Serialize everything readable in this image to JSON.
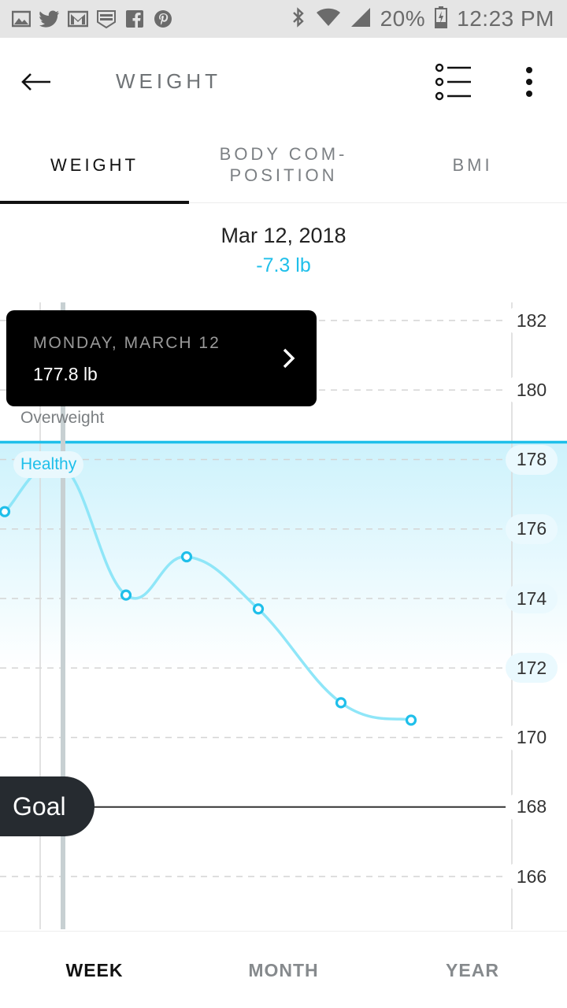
{
  "status_bar": {
    "left_icons": [
      "image-icon",
      "twitter-icon",
      "gmail-icon",
      "crossfit-games-icon",
      "facebook-icon",
      "pinterest-icon"
    ],
    "right_icons": [
      "bluetooth-icon",
      "wifi-icon",
      "cell-signal-icon",
      "battery-icon"
    ],
    "battery": "20%",
    "time": "12:23 PM"
  },
  "app_bar": {
    "title": "WEIGHT"
  },
  "tabs": [
    {
      "label": "WEIGHT",
      "active": true
    },
    {
      "label": "BODY COM-\nPOSITION",
      "active": false
    },
    {
      "label": "BMI",
      "active": false
    }
  ],
  "summary": {
    "date": "Mar 12, 2018",
    "delta": "-7.3 lb"
  },
  "tooltip": {
    "day": "MONDAY, MARCH 12",
    "value": "177.8 lb"
  },
  "zones": {
    "overweight_label": "Overweight",
    "healthy_label": "Healthy",
    "boundary": 178.5
  },
  "goal": {
    "label": "Goal",
    "value": 168
  },
  "colors": {
    "accent": "#1fbfea",
    "line": "#8fe6f8",
    "healthy_fill": "#cdf2fc",
    "tooltip_bg": "#000000",
    "goal_pill": "#262b30"
  },
  "chart_data": {
    "type": "line",
    "y_ticks": [
      182,
      180,
      178,
      176,
      174,
      172,
      170,
      168,
      166
    ],
    "ylim": [
      164.5,
      183
    ],
    "values": [
      176.5,
      177.8,
      174.1,
      175.2,
      173.7,
      171.0,
      170.5
    ],
    "points_marked": [
      true,
      false,
      true,
      true,
      true,
      true,
      true
    ],
    "selected_index": 1,
    "goal": 168,
    "grid": true
  },
  "bottom_tabs": [
    {
      "label": "WEEK",
      "active": true
    },
    {
      "label": "MONTH",
      "active": false
    },
    {
      "label": "YEAR",
      "active": false
    }
  ]
}
